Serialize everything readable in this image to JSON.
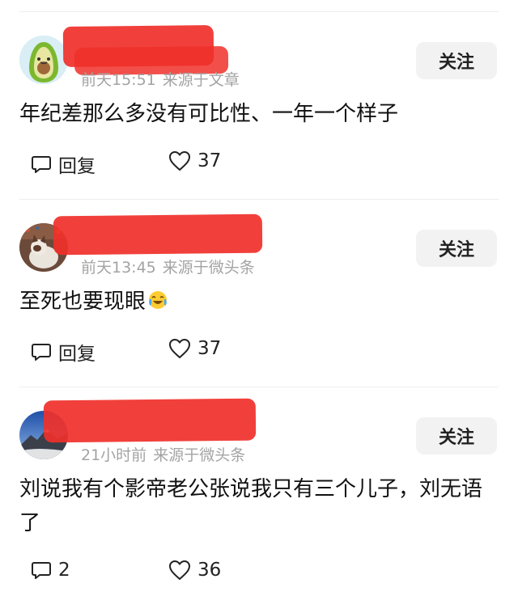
{
  "comments": [
    {
      "username_hidden": "",
      "time": "前天15:51",
      "source": "来源于文章",
      "follow_label": "关注",
      "content": "年纪差那么多没有可比性、一年一个样子",
      "reply_label": "回复",
      "like_count": "37",
      "avatar_icon": "avocado-avatar-icon"
    },
    {
      "username_hidden": "",
      "time": "前天13:45",
      "source": "来源于微头条",
      "follow_label": "关注",
      "content": "至死也要现眼",
      "content_emoji": "laughing-crying-emoji-icon",
      "reply_label": "回复",
      "like_count": "37",
      "avatar_icon": "cat-avatar-icon"
    },
    {
      "username_hidden": "",
      "time": "21小时前",
      "source": "来源于微头条",
      "follow_label": "关注",
      "content": "刘说我有个影帝老公张说我只有三个儿子，刘无语了",
      "reply_count": "2",
      "like_count": "36",
      "avatar_icon": "mountain-avatar-icon"
    }
  ],
  "colors": {
    "redaction": "#f0302a",
    "meta_text": "#a3a3a3",
    "follow_bg": "#f2f2f2"
  }
}
